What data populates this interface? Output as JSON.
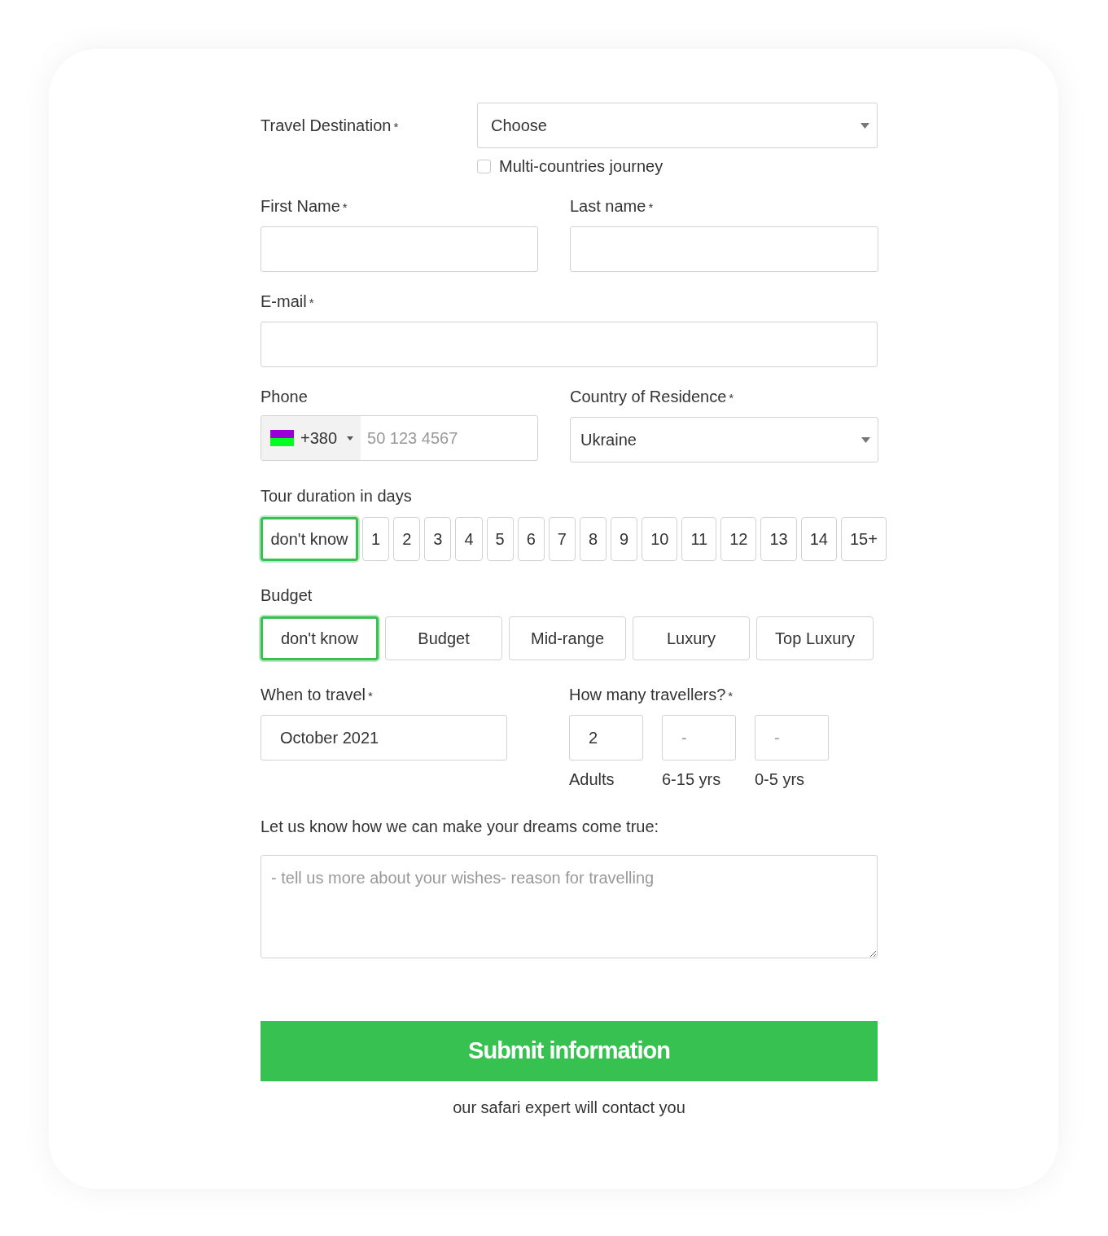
{
  "destination": {
    "label": "Travel Destination",
    "mark": "*",
    "value": "Choose",
    "checkbox": {
      "label": "Multi-countries journey",
      "checked": false
    }
  },
  "first_name": {
    "label": "First Name",
    "mark": "*"
  },
  "last_name": {
    "label": "Last name",
    "mark": "*"
  },
  "email": {
    "label": "E-mail",
    "mark": "*"
  },
  "phone": {
    "label": "Phone",
    "code": "+380",
    "placeholder": "50 123 4567"
  },
  "country": {
    "label": "Country of Residence",
    "mark": "*",
    "value": "Ukraine"
  },
  "duration": {
    "label": "Tour duration in days",
    "options": [
      {
        "label": "don't know",
        "selected": true
      },
      {
        "label": "1",
        "selected": false
      },
      {
        "label": "2",
        "selected": false
      },
      {
        "label": "3",
        "selected": false
      },
      {
        "label": "4",
        "selected": false
      },
      {
        "label": "5",
        "selected": false
      },
      {
        "label": "6",
        "selected": false
      },
      {
        "label": "7",
        "selected": false
      },
      {
        "label": "8",
        "selected": false
      },
      {
        "label": "9",
        "selected": false
      },
      {
        "label": "10",
        "selected": false
      },
      {
        "label": "11",
        "selected": false
      },
      {
        "label": "12",
        "selected": false
      },
      {
        "label": "13",
        "selected": false
      },
      {
        "label": "14",
        "selected": false
      },
      {
        "label": "15+",
        "selected": false
      }
    ]
  },
  "budget": {
    "label": "Budget",
    "options": [
      {
        "label": "don't know",
        "selected": true
      },
      {
        "label": "Budget",
        "selected": false
      },
      {
        "label": "Mid-range",
        "selected": false
      },
      {
        "label": "Luxury",
        "selected": false
      },
      {
        "label": "Top Luxury",
        "selected": false
      }
    ]
  },
  "when": {
    "label": "When to travel",
    "mark": "*",
    "value": "October 2021"
  },
  "travellers": {
    "label": "How many travellers?",
    "mark": "*",
    "counts": [
      {
        "value": "2",
        "caption": "Adults"
      },
      {
        "placeholder": "-",
        "caption": "6-15 yrs"
      },
      {
        "placeholder": "-",
        "caption": "0-5 yrs"
      }
    ]
  },
  "wishes": {
    "label": "Let us know how we can make your dreams come true:",
    "placeholder": "- tell us more about your wishes- reason for travelling"
  },
  "submit": "Submit information",
  "note": "our safari expert will contact you"
}
